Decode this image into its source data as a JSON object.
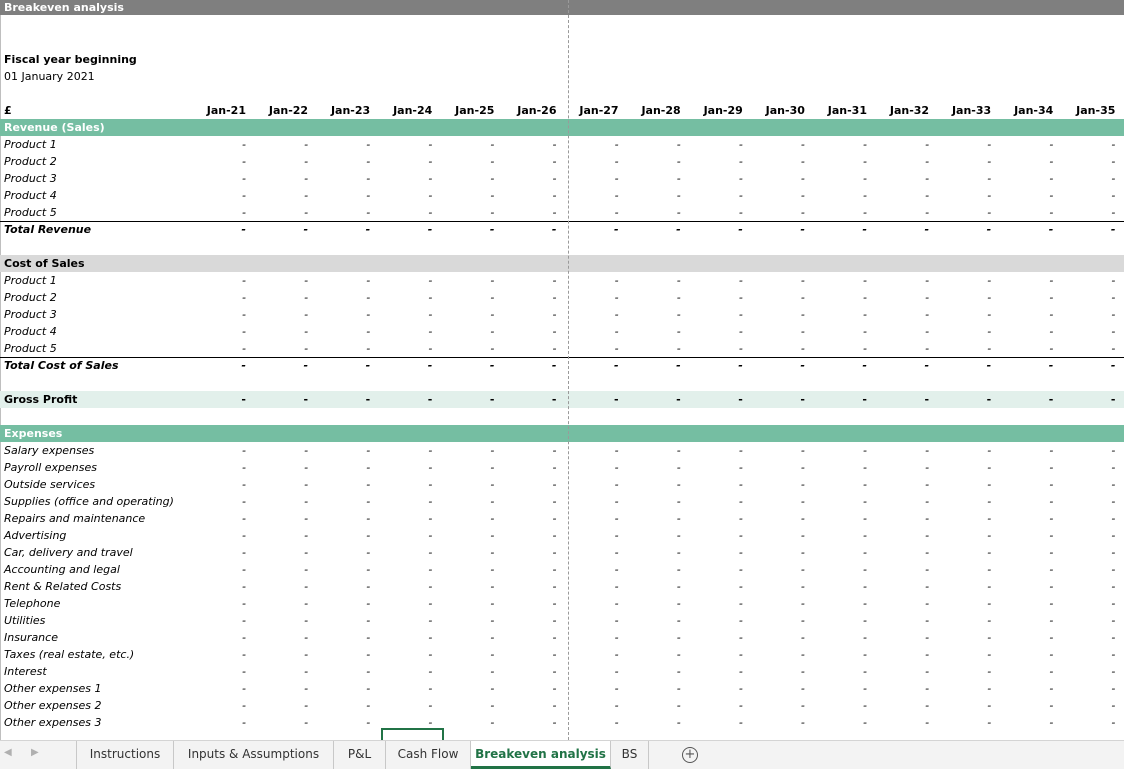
{
  "sheet": {
    "title": "Breakeven analysis",
    "fiscal_label": "Fiscal year beginning",
    "fiscal_date": "01 January 2021",
    "currency": "£",
    "columns": [
      "Jan-21",
      "Jan-22",
      "Jan-23",
      "Jan-24",
      "Jan-25",
      "Jan-26",
      "Jan-27",
      "Jan-28",
      "Jan-29",
      "Jan-30",
      "Jan-31",
      "Jan-32",
      "Jan-33",
      "Jan-34",
      "Jan-35"
    ],
    "empty_value": "-",
    "revenue": {
      "header": "Revenue (Sales)",
      "items": [
        "Product 1",
        "Product 2",
        "Product 3",
        "Product 4",
        "Product 5"
      ],
      "total": "Total Revenue"
    },
    "cost_of_sales": {
      "header": "Cost of Sales",
      "items": [
        "Product 1",
        "Product 2",
        "Product 3",
        "Product 4",
        "Product 5"
      ],
      "total": "Total Cost of Sales"
    },
    "gross_profit": "Gross Profit",
    "expenses": {
      "header": "Expenses",
      "items": [
        "Salary expenses",
        "Payroll expenses",
        "Outside services",
        "Supplies (office and operating)",
        "Repairs and maintenance",
        "Advertising",
        "Car, delivery and travel",
        "Accounting and legal",
        "Rent & Related Costs",
        "Telephone",
        "Utilities",
        "Insurance",
        "Taxes (real estate, etc.)",
        "Interest",
        "Other expenses 1",
        "Other expenses 2",
        "Other expenses 3"
      ]
    }
  },
  "tabs": [
    {
      "label": "Instructions",
      "active": false
    },
    {
      "label": "Inputs & Assumptions",
      "active": false
    },
    {
      "label": "P&L",
      "active": false
    },
    {
      "label": "Cash Flow",
      "active": false
    },
    {
      "label": "Breakeven analysis",
      "active": true
    },
    {
      "label": "BS",
      "active": false
    }
  ],
  "icons": {
    "nav_prev": "triangle-left-icon",
    "nav_next": "triangle-right-icon",
    "add_sheet": "plus-circle-icon"
  },
  "colors": {
    "title_bar": "#7f7f7f",
    "section_header": "#75bea2",
    "cost_header": "#d9d9d9",
    "gross_profit_row": "#e2f0eb",
    "active_tab": "#217346"
  }
}
